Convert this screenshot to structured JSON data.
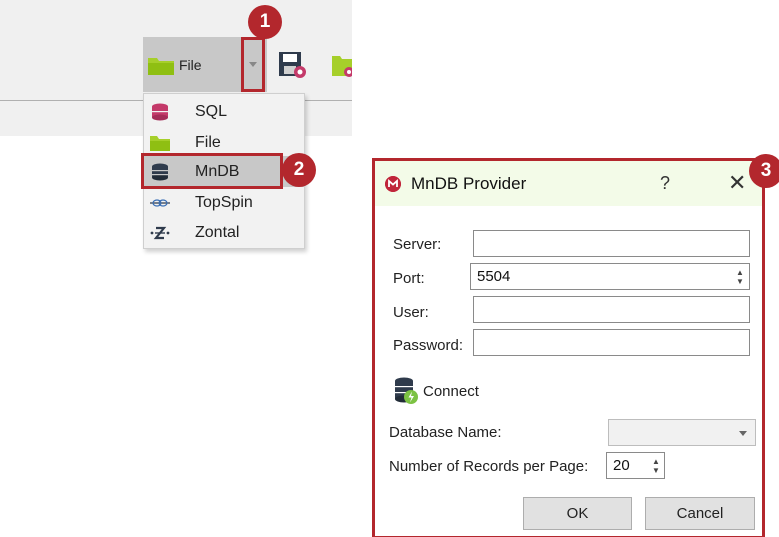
{
  "toolbar": {
    "file_label": "File"
  },
  "callouts": [
    "1",
    "2",
    "3"
  ],
  "menu": {
    "items": [
      {
        "label": "SQL",
        "icon": "database-pink-icon"
      },
      {
        "label": "File",
        "icon": "folder-icon"
      },
      {
        "label": "MnDB",
        "icon": "database-dark-icon",
        "selected": true
      },
      {
        "label": "TopSpin",
        "icon": "topspin-icon"
      },
      {
        "label": "Zontal",
        "icon": "zontal-icon"
      }
    ]
  },
  "dialog": {
    "title": "MnDB Provider",
    "help": "?",
    "close": "✕",
    "server_label": "Server:",
    "server_value": "",
    "port_label": "Port:",
    "port_value": "5504",
    "user_label": "User:",
    "user_value": "",
    "password_label": "Password:",
    "password_value": "",
    "connect_label": "Connect",
    "database_name_label": "Database Name:",
    "database_name_value": "",
    "records_label": "Number of Records per Page:",
    "records_value": "20",
    "ok_label": "OK",
    "cancel_label": "Cancel"
  },
  "colors": {
    "accent_red": "#b3272d",
    "title_bar_green": "#f3fbe8",
    "folder_green": "#a6cf2a",
    "database_pink": "#c43a6a",
    "database_dark": "#2f3b4c"
  }
}
